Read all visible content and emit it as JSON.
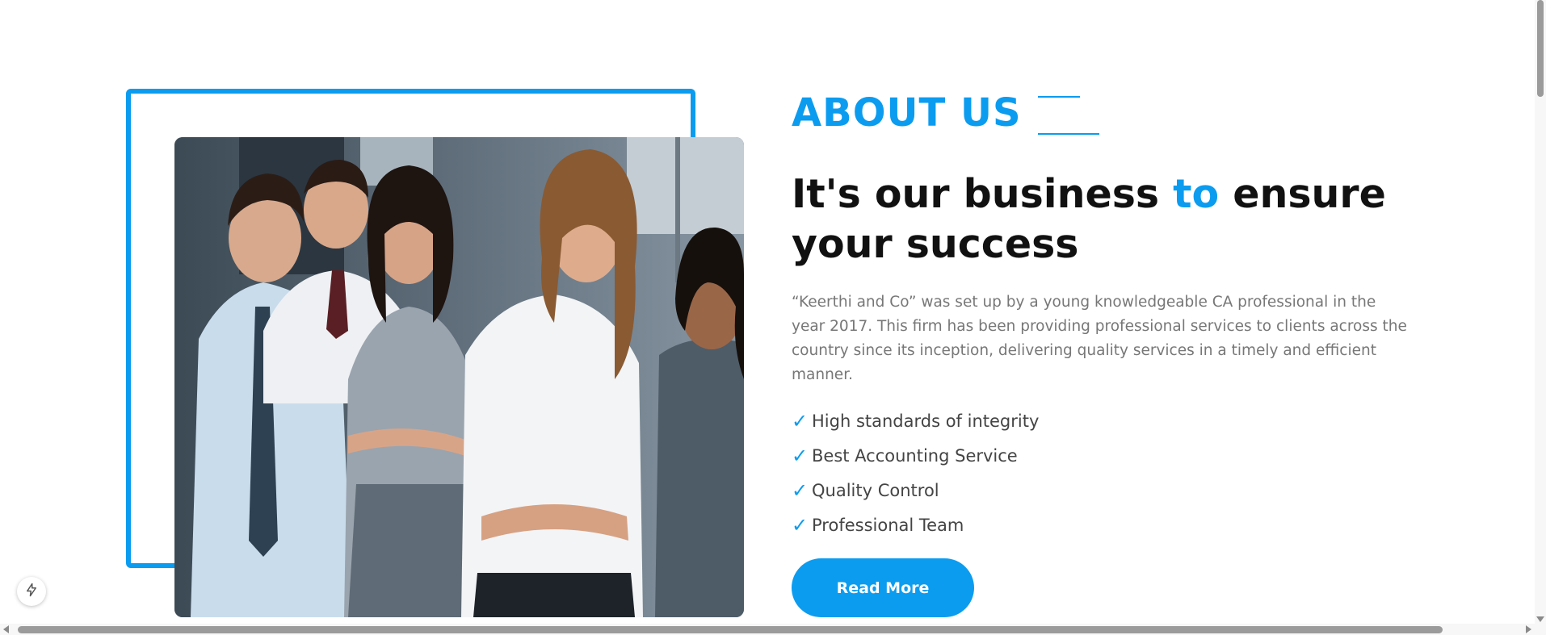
{
  "about": {
    "eyebrow": "ABOUT US",
    "headline_part1": "It's our business ",
    "headline_accent": "to",
    "headline_part2": " ensure your success",
    "description": "“Keerthi and Co” was set up by a young knowledgeable CA professional in the year 2017. This firm has been providing professional services to clients across the country since its inception, delivering quality services in a timely and efficient manner.",
    "features": [
      "High standards of integrity",
      "Best Accounting Service",
      "Quality Control",
      "Professional Team"
    ],
    "check_glyph": "✓",
    "cta_label": "Read More"
  },
  "colors": {
    "accent": "#0b9cf0",
    "headline": "#111111",
    "body_text": "#777777",
    "feature_text": "#444444"
  },
  "icons": {
    "feature_check": "check-icon",
    "floating_widget": "lightning-bolt-icon"
  }
}
